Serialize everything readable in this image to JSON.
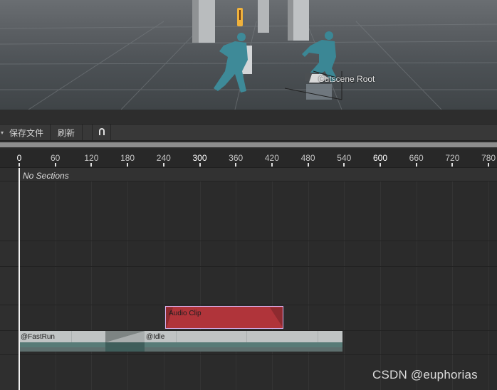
{
  "scene": {
    "label": "Cutscene Root"
  },
  "toolbar": {
    "menu_arrow": "▾",
    "save_label": "保存文件",
    "refresh_label": "刷新",
    "snap_icon": "∩"
  },
  "ruler": {
    "labels": [
      "0",
      "60",
      "120",
      "180",
      "240",
      "300",
      "360",
      "420",
      "480",
      "540",
      "600",
      "660",
      "720",
      "780"
    ],
    "major": [
      "0",
      "300",
      "600"
    ]
  },
  "timeline": {
    "no_sections": "No Sections",
    "audio_clip_label": "Audio Clip",
    "fastrun_label": "@FastRun",
    "idle_label": "@Idle"
  },
  "colors": {
    "audio_clip": "#b0343a",
    "audio_border": "#d8b2f0",
    "anim_clip": "#c0c4c4",
    "anim_band": "#587b77"
  },
  "watermark": "CSDN @euphorias"
}
